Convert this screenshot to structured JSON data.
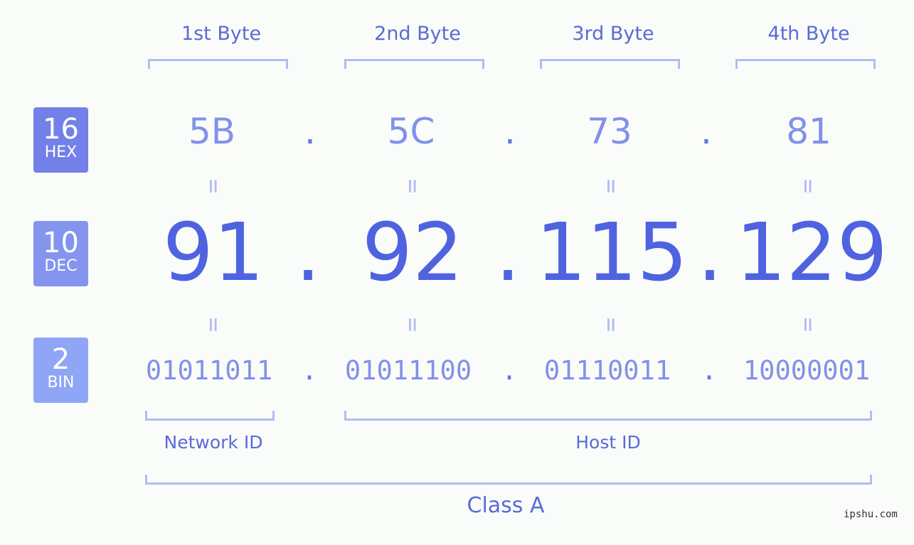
{
  "byte_headers": [
    "1st Byte",
    "2nd Byte",
    "3rd Byte",
    "4th Byte"
  ],
  "rows": {
    "hex": {
      "badge_number": "16",
      "badge_label": "HEX",
      "badge_color": "#7380e8",
      "values": [
        "5B",
        "5C",
        "73",
        "81"
      ]
    },
    "dec": {
      "badge_number": "10",
      "badge_label": "DEC",
      "badge_color": "#8494ef",
      "values": [
        "91",
        "92",
        "115",
        "129"
      ]
    },
    "bin": {
      "badge_number": "2",
      "badge_label": "BIN",
      "badge_color": "#8ea6f5",
      "values": [
        "01011011",
        "01011100",
        "01110011",
        "10000001"
      ]
    }
  },
  "separator": ".",
  "equals_symbol": "=",
  "network_id_label": "Network ID",
  "host_id_label": "Host ID",
  "class_label": "Class A",
  "watermark": "ipshu.com"
}
